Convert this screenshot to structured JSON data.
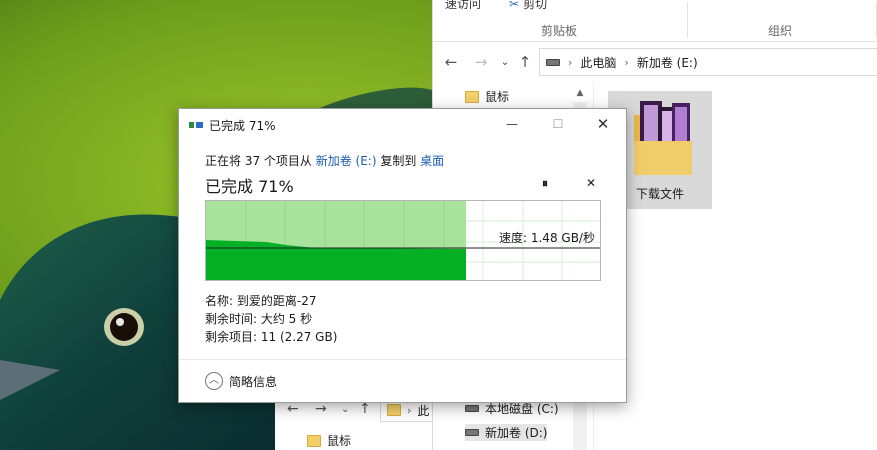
{
  "explorer": {
    "ribbon": {
      "quick_access": "速访问",
      "cut": "剪切",
      "clipboard_group": "剪贴板",
      "organize_group": "组织"
    },
    "nav": {
      "back": "←",
      "forward": "→",
      "recent": "⌄",
      "up": "↑"
    },
    "address": {
      "crumb1": "此电脑",
      "crumb2": "新加卷 (E:)"
    },
    "tree": {
      "item1": "鼠标"
    },
    "content": {
      "tile_label": "下载文件"
    },
    "drives": [
      "本地磁盘 (C:)",
      "新加卷 (D:)"
    ]
  },
  "explorer2": {
    "address_crumb": "此",
    "tree_item": "鼠标"
  },
  "dialog": {
    "title": "已完成 71%",
    "description": {
      "prefix": "正在将 37 个项目从 ",
      "source": "新加卷 (E:)",
      "middle": " 复制到 ",
      "dest": "桌面"
    },
    "heading": "已完成 71%",
    "speed": "速度: 1.48 GB/秒",
    "progress_percent": 71,
    "name": "名称: 到爱的距离-27",
    "remaining_time": "剩余时间: 大约 5 秒",
    "remaining_items": "剩余项目: 11 (2.27 GB)",
    "footer_toggle": "简略信息",
    "controls": {
      "pause": "⏸",
      "cancel": "✕",
      "minimize": "—",
      "maximize": "☐",
      "close": "✕"
    },
    "colors": {
      "progress_fill": "#a8e39b",
      "speed_fill": "#06b025",
      "link": "#1a5fb4"
    }
  }
}
